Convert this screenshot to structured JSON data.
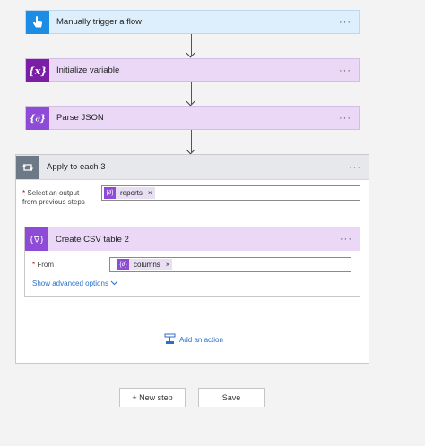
{
  "flow": {
    "steps": [
      {
        "title": "Manually trigger a flow",
        "icon": "hand-tap-icon",
        "menu": "···"
      },
      {
        "title": "Initialize variable",
        "icon": "variable-icon",
        "menu": "···"
      },
      {
        "title": "Parse JSON",
        "icon": "data-operation-icon",
        "menu": "···"
      }
    ],
    "apply_to_each": {
      "title": "Apply to each 3",
      "menu": "···",
      "icon": "loop-icon",
      "select_output": {
        "required_mark": "*",
        "label_line1": "Select an output",
        "label_line2": "from previous steps",
        "token": "reports",
        "token_remove": "×"
      },
      "csv_table": {
        "title": "Create CSV table 2",
        "menu": "···",
        "icon": "csv-table-icon",
        "from": {
          "required_mark": "*",
          "label": "From",
          "token": "columns",
          "token_remove": "×"
        },
        "show_advanced": "Show advanced options"
      },
      "add_action": "Add an action"
    },
    "buttons": {
      "new_step": "+ New step",
      "save": "Save"
    }
  },
  "colors": {
    "trigger_accent": "#1d8ce3",
    "variable_accent": "#7a1fa5",
    "data_op_accent": "#8e4bd7",
    "loop_accent": "#6e7987",
    "link": "#2a6fc9"
  }
}
